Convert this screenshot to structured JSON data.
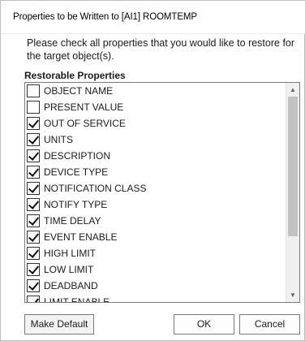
{
  "window": {
    "title": "Properties to be Written to [AI1] ROOMTEMP"
  },
  "instructions": "Please check all properties that you would like to restore for the target object(s).",
  "group": {
    "label": "Restorable Properties"
  },
  "properties": [
    {
      "label": "OBJECT NAME",
      "checked": false
    },
    {
      "label": "PRESENT VALUE",
      "checked": false
    },
    {
      "label": "OUT OF SERVICE",
      "checked": true
    },
    {
      "label": "UNITS",
      "checked": true
    },
    {
      "label": "DESCRIPTION",
      "checked": true
    },
    {
      "label": "DEVICE TYPE",
      "checked": true
    },
    {
      "label": "NOTIFICATION CLASS",
      "checked": true
    },
    {
      "label": "NOTIFY TYPE",
      "checked": true
    },
    {
      "label": "TIME DELAY",
      "checked": true
    },
    {
      "label": "EVENT ENABLE",
      "checked": true
    },
    {
      "label": "HIGH LIMIT",
      "checked": true
    },
    {
      "label": "LOW LIMIT",
      "checked": true
    },
    {
      "label": "DEADBAND",
      "checked": true
    },
    {
      "label": "LIMIT ENABLE",
      "checked": true
    }
  ],
  "buttons": {
    "make_default": "Make Default",
    "ok": "OK",
    "cancel": "Cancel"
  }
}
